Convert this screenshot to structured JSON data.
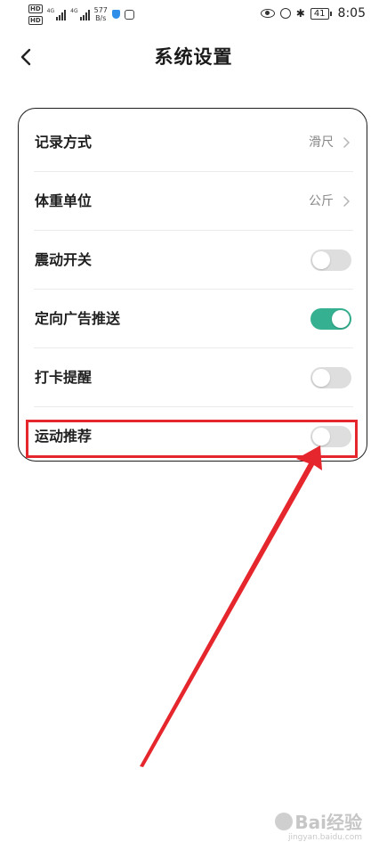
{
  "status_bar": {
    "hd_badge": "HD",
    "network_gen": "4G",
    "speed_value": "577",
    "speed_unit": "B/s",
    "battery": "41",
    "time": "8:05"
  },
  "header": {
    "title": "系统设置"
  },
  "settings": [
    {
      "label": "记录方式",
      "value": "滑尺",
      "control": "chevron"
    },
    {
      "label": "体重单位",
      "value": "公斤",
      "control": "chevron"
    },
    {
      "label": "震动开关",
      "control": "toggle",
      "on": false
    },
    {
      "label": "定向广告推送",
      "control": "toggle",
      "on": true
    },
    {
      "label": "打卡提醒",
      "control": "toggle",
      "on": false
    },
    {
      "label": "运动推荐",
      "control": "toggle",
      "on": false
    }
  ],
  "colors": {
    "toggle_on": "#35b090",
    "toggle_off": "#dedede",
    "annotation": "#e5262c"
  },
  "watermark": {
    "text": "Bai经验",
    "sub": "jingyan.baidu.com"
  }
}
